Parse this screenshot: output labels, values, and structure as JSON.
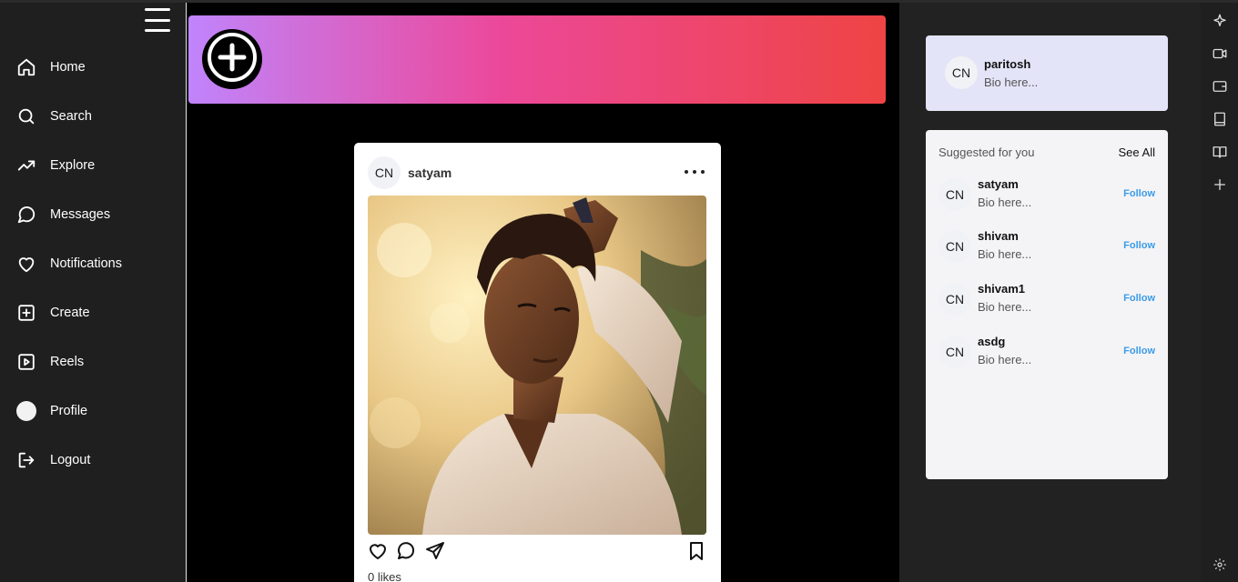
{
  "sidebar": {
    "items": [
      {
        "label": "Home",
        "icon": "home-icon"
      },
      {
        "label": "Search",
        "icon": "search-icon"
      },
      {
        "label": "Explore",
        "icon": "trending-up-icon"
      },
      {
        "label": "Messages",
        "icon": "message-circle-icon"
      },
      {
        "label": "Notifications",
        "icon": "heart-icon"
      },
      {
        "label": "Create",
        "icon": "plus-square-icon"
      },
      {
        "label": "Reels",
        "icon": "play-square-icon"
      },
      {
        "label": "Profile",
        "icon": "avatar"
      },
      {
        "label": "Logout",
        "icon": "logout-icon"
      }
    ]
  },
  "banner": {
    "gradient": [
      "#c084fc",
      "#ec4899",
      "#ef4444"
    ]
  },
  "post": {
    "avatar_text": "CN",
    "username": "satyam",
    "likes": "0 likes"
  },
  "me": {
    "avatar_text": "CN",
    "username": "paritosh",
    "bio": "Bio here..."
  },
  "suggested": {
    "title": "Suggested for you",
    "see_all": "See All",
    "users": [
      {
        "avatar_text": "CN",
        "username": "satyam",
        "bio": "Bio here...",
        "action": "Follow"
      },
      {
        "avatar_text": "CN",
        "username": "shivam",
        "bio": "Bio here...",
        "action": "Follow"
      },
      {
        "avatar_text": "CN",
        "username": "shivam1",
        "bio": "Bio here...",
        "action": "Follow"
      },
      {
        "avatar_text": "CN",
        "username": "asdg",
        "bio": "Bio here...",
        "action": "Follow"
      }
    ]
  },
  "colors": {
    "follow": "#3b9be8",
    "me_card": "#e3e4f7",
    "sidebar_bg": "#1f1f1f"
  }
}
